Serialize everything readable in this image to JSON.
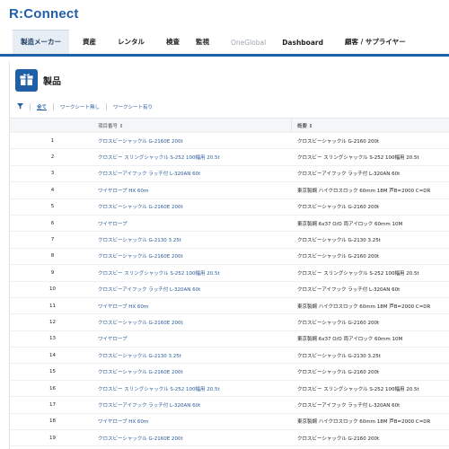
{
  "app": {
    "logo": "R:Connect"
  },
  "nav": [
    {
      "label": "製造メーカー",
      "active": true
    },
    {
      "label": "資産"
    },
    {
      "label": "レンタル"
    },
    {
      "label": "検査"
    },
    {
      "label": "監視"
    },
    {
      "label": "OneGlobal",
      "muted": true
    },
    {
      "label": "Dashboard"
    },
    {
      "label": "顧客 / サプライヤー"
    }
  ],
  "panel": {
    "title": "製品",
    "toolbar": {
      "all": "全て",
      "no_worksheet": "ワークシート無し",
      "with_worksheet": "ワークシート有り"
    }
  },
  "table": {
    "columns": {
      "item_no": "項目番号 ⇕",
      "description": "概要 ⇕"
    },
    "rows": [
      {
        "n": "1",
        "item": "クロスビーシャックル G-2160E 200t",
        "desc": "クロスビーシャックル G-2160 200t"
      },
      {
        "n": "2",
        "item": "クロスビー スリングシャックル S-252 100幅用 20.5t",
        "desc": "クロスビー スリングシャックル S-252 100幅用 20.5t"
      },
      {
        "n": "3",
        "item": "クロスビーアイフック ラッチ付 L-320AN 60t",
        "desc": "クロスビーアイフック ラッチ付 L-320AN 60t"
      },
      {
        "n": "4",
        "item": "ワイヤロープ HX 60ｍ",
        "desc": "東京製綱 ハイクロスロック 60mm 18M 芦B=2000 C=DR"
      },
      {
        "n": "5",
        "item": "クロスビーシャックル G-2160E 200t",
        "desc": "クロスビーシャックル G-2160 200t"
      },
      {
        "n": "6",
        "item": "ワイヤロープ",
        "desc": "東京製綱 6x37 O/O 両アイロック 60mm 10M"
      },
      {
        "n": "7",
        "item": "クロスビーシャックル G-2130 3.25t",
        "desc": "クロスビーシャックル G-2130 3.25t"
      },
      {
        "n": "8",
        "item": "クロスビーシャックル G-2160E 200t",
        "desc": "クロスビーシャックル G-2160 200t"
      },
      {
        "n": "9",
        "item": "クロスビー スリングシャックル S-252 100幅用 20.5t",
        "desc": "クロスビー スリングシャックル S-252 100幅用 20.5t"
      },
      {
        "n": "10",
        "item": "クロスビーアイフック ラッチ付 L-320AN 60t",
        "desc": "クロスビーアイフック ラッチ付 L-320AN 60t"
      },
      {
        "n": "11",
        "item": "ワイヤロープ HX 60ｍ",
        "desc": "東京製綱 ハイクロスロック 60mm 18M 芦B=2000 C=DR"
      },
      {
        "n": "12",
        "item": "クロスビーシャックル G-2160E 200t",
        "desc": "クロスビーシャックル G-2160 200t"
      },
      {
        "n": "13",
        "item": "ワイヤロープ",
        "desc": "東京製綱 6x37 O/O 両アイロック 60mm 10M"
      },
      {
        "n": "14",
        "item": "クロスビーシャックル G-2130 3.25t",
        "desc": "クロスビーシャックル G-2130 3.25t"
      },
      {
        "n": "15",
        "item": "クロスビーシャックル G-2160E 200t",
        "desc": "クロスビーシャックル G-2160 200t"
      },
      {
        "n": "16",
        "item": "クロスビー スリングシャックル S-252 100幅用 20.5t",
        "desc": "クロスビー スリングシャックル S-252 100幅用 20.5t"
      },
      {
        "n": "17",
        "item": "クロスビーアイフック ラッチ付 L-320AN 60t",
        "desc": "クロスビーアイフック ラッチ付 L-320AN 60t"
      },
      {
        "n": "18",
        "item": "ワイヤロープ HX 60ｍ",
        "desc": "東京製綱 ハイクロスロック 60mm 18M 芦B=2000 C=DR"
      },
      {
        "n": "19",
        "item": "クロスビーシャックル G-2160E 200t",
        "desc": "クロスビーシャックル G-2160 200t"
      }
    ]
  },
  "colors": {
    "brand": "#1f5fa8",
    "link": "#2a5a98"
  }
}
